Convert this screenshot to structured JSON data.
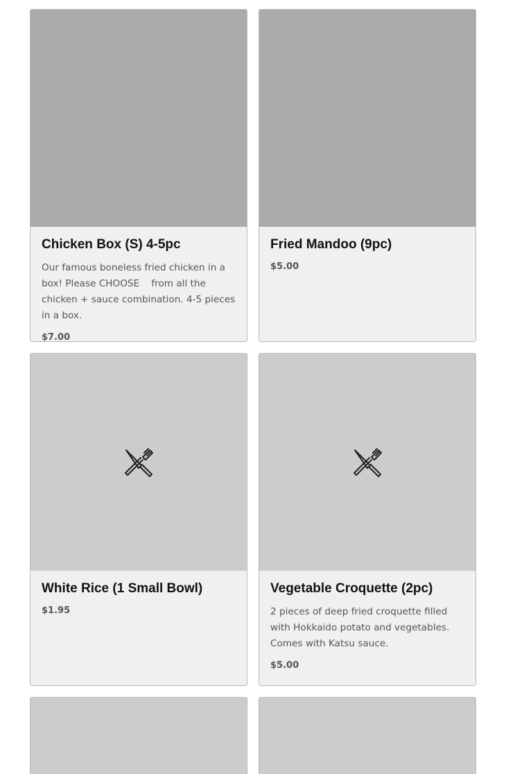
{
  "menu_items": [
    {
      "name": "Chicken Box (S) 4-5pc",
      "description": "Our famous boneless fried chicken in a box! Please CHOOSE    from all the chicken + sauce combination. 4-5 pieces in a box.",
      "price": "$7.00",
      "image": "photo"
    },
    {
      "name": "Fried Mandoo (9pc)",
      "description": "",
      "price": "$5.00",
      "image": "photo"
    },
    {
      "name": "White Rice (1 Small Bowl)",
      "description": "",
      "price": "$1.95",
      "image": "fork-knife-placeholder-icon"
    },
    {
      "name": "Vegetable Croquette (2pc)",
      "description": "2 pieces of deep fried croquette filled with Hokkaido potato and vegetables. Comes with Katsu sauce.",
      "price": "$5.00",
      "image": "fork-knife-placeholder-icon"
    }
  ],
  "colors": {
    "card_background": "#f0f0f0",
    "photo_placeholder": "#aaaaaa",
    "icon_placeholder": "#cccccc",
    "card_border": "#b9b9b9"
  }
}
